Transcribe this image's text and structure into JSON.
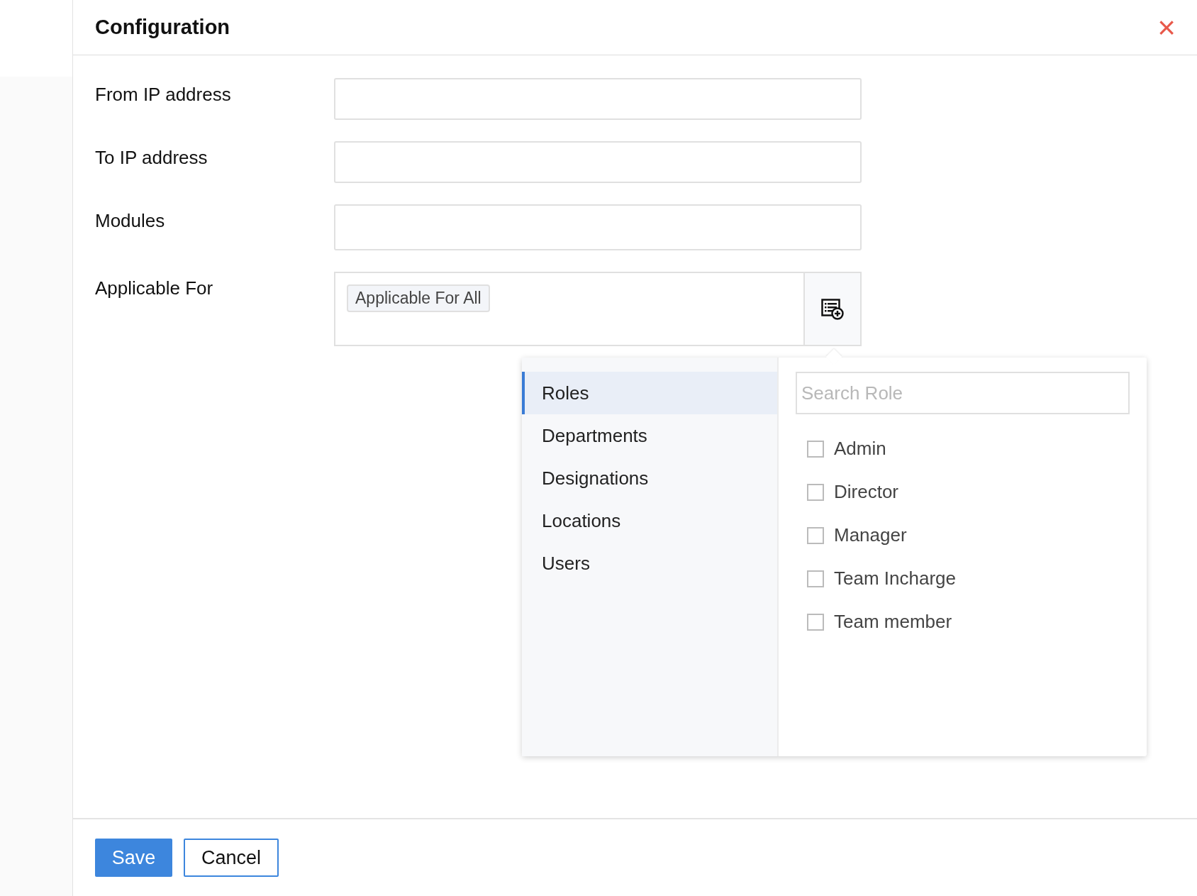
{
  "dialog": {
    "title": "Configuration",
    "close": "×"
  },
  "fields": [
    {
      "label": "From IP address"
    },
    {
      "label": "To IP address"
    },
    {
      "label": "Modules"
    }
  ],
  "applicable_for": {
    "label": "Applicable For",
    "tags": [
      "Applicable For All"
    ]
  },
  "popover": {
    "categories": [
      {
        "label": "Roles",
        "selected": true
      },
      {
        "label": "Departments",
        "selected": false
      },
      {
        "label": "Designations",
        "selected": false
      },
      {
        "label": "Locations",
        "selected": false
      },
      {
        "label": "Users",
        "selected": false
      }
    ],
    "search": {
      "placeholder": "Search Role"
    },
    "options": [
      {
        "label": "Admin",
        "checked": false
      },
      {
        "label": "Director",
        "checked": false
      },
      {
        "label": "Manager",
        "checked": false
      },
      {
        "label": "Team Incharge",
        "checked": false
      },
      {
        "label": "Team member",
        "checked": false
      }
    ]
  },
  "buttons": [
    {
      "label": "Save",
      "kind": "primary"
    },
    {
      "label": "Cancel",
      "kind": "secondary"
    }
  ]
}
